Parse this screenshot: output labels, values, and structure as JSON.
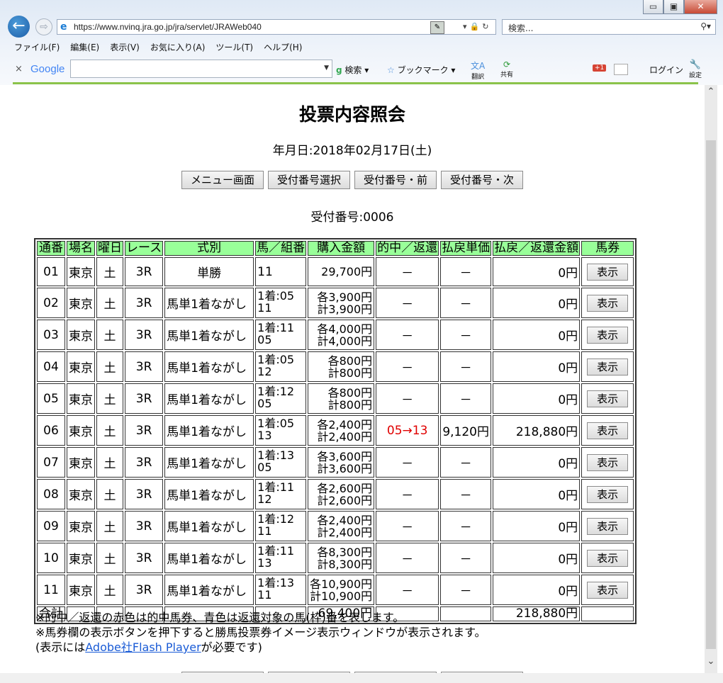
{
  "browser": {
    "url": "https://www.nvinq.jra.go.jp/jra/servlet/JRAWeb040",
    "search_placeholder": "検索...",
    "window_controls": {
      "minimize": "▭",
      "restore": "▣",
      "close": "✕"
    },
    "menu": [
      "ファイル(F)",
      "編集(E)",
      "表示(V)",
      "お気に入り(A)",
      "ツール(T)",
      "ヘルプ(H)"
    ],
    "toolbar": {
      "google_logo": "Google",
      "search_label": "検索",
      "bookmark_label": "ブックマーク",
      "translate_label": "翻訳",
      "share_label": "共有",
      "gplus_label": "+1",
      "login_label": "ログイン",
      "settings_label": "設定"
    }
  },
  "page": {
    "title": "投票内容照会",
    "date": "年月日:2018年02月17日(土)",
    "nav_buttons": [
      "メニュー画面",
      "受付番号選択",
      "受付番号・前",
      "受付番号・次"
    ],
    "receipt": "受付番号:0006",
    "table": {
      "headers": [
        "通番",
        "場名",
        "曜日",
        "レース",
        "式別",
        "馬／組番",
        "購入金額",
        "的中／返還",
        "払戻単価",
        "払戻／返還金額",
        "馬券"
      ],
      "show_label": "表示",
      "rows": [
        {
          "no": "01",
          "place": "東京",
          "day": "土",
          "race": "3R",
          "type": "単勝",
          "horse1": "11",
          "horse2": "",
          "amt1": "29,700円",
          "amt2": "",
          "hit": "－",
          "unit": "－",
          "payout": "0円"
        },
        {
          "no": "02",
          "place": "東京",
          "day": "土",
          "race": "3R",
          "type": "馬単1着ながし",
          "horse1": "1着:05",
          "horse2": "11",
          "amt1": "各3,900円",
          "amt2": "計3,900円",
          "hit": "－",
          "unit": "－",
          "payout": "0円"
        },
        {
          "no": "03",
          "place": "東京",
          "day": "土",
          "race": "3R",
          "type": "馬単1着ながし",
          "horse1": "1着:11",
          "horse2": "05",
          "amt1": "各4,000円",
          "amt2": "計4,000円",
          "hit": "－",
          "unit": "－",
          "payout": "0円"
        },
        {
          "no": "04",
          "place": "東京",
          "day": "土",
          "race": "3R",
          "type": "馬単1着ながし",
          "horse1": "1着:05",
          "horse2": "12",
          "amt1": "各800円",
          "amt2": "計800円",
          "hit": "－",
          "unit": "－",
          "payout": "0円"
        },
        {
          "no": "05",
          "place": "東京",
          "day": "土",
          "race": "3R",
          "type": "馬単1着ながし",
          "horse1": "1着:12",
          "horse2": "05",
          "amt1": "各800円",
          "amt2": "計800円",
          "hit": "－",
          "unit": "－",
          "payout": "0円"
        },
        {
          "no": "06",
          "place": "東京",
          "day": "土",
          "race": "3R",
          "type": "馬単1着ながし",
          "horse1": "1着:05",
          "horse2": "13",
          "amt1": "各2,400円",
          "amt2": "計2,400円",
          "hit": "05→13",
          "unit": "9,120円",
          "payout": "218,880円"
        },
        {
          "no": "07",
          "place": "東京",
          "day": "土",
          "race": "3R",
          "type": "馬単1着ながし",
          "horse1": "1着:13",
          "horse2": "05",
          "amt1": "各3,600円",
          "amt2": "計3,600円",
          "hit": "－",
          "unit": "－",
          "payout": "0円"
        },
        {
          "no": "08",
          "place": "東京",
          "day": "土",
          "race": "3R",
          "type": "馬単1着ながし",
          "horse1": "1着:11",
          "horse2": "12",
          "amt1": "各2,600円",
          "amt2": "計2,600円",
          "hit": "－",
          "unit": "－",
          "payout": "0円"
        },
        {
          "no": "09",
          "place": "東京",
          "day": "土",
          "race": "3R",
          "type": "馬単1着ながし",
          "horse1": "1着:12",
          "horse2": "11",
          "amt1": "各2,400円",
          "amt2": "計2,400円",
          "hit": "－",
          "unit": "－",
          "payout": "0円"
        },
        {
          "no": "10",
          "place": "東京",
          "day": "土",
          "race": "3R",
          "type": "馬単1着ながし",
          "horse1": "1着:11",
          "horse2": "13",
          "amt1": "各8,300円",
          "amt2": "計8,300円",
          "hit": "－",
          "unit": "－",
          "payout": "0円"
        },
        {
          "no": "11",
          "place": "東京",
          "day": "土",
          "race": "3R",
          "type": "馬単1着ながし",
          "horse1": "1着:13",
          "horse2": "11",
          "amt1": "各10,900円",
          "amt2": "計10,900円",
          "hit": "－",
          "unit": "－",
          "payout": "0円"
        }
      ],
      "total": {
        "label": "合計",
        "amount": "69,400円",
        "payout": "218,880円"
      }
    },
    "notes": {
      "line1": "※的中／返還の赤色は的中馬券、青色は返還対象の馬(枠)番を表します。",
      "line2": "※馬券欄の表示ボタンを押下すると勝馬投票券イメージ表示ウィンドウが表示されます。",
      "line3_pre": "(表示には",
      "line3_link": "Adobe社Flash Player",
      "line3_post": "が必要です)"
    },
    "hit_color": "#e00000",
    "header_color": "#99ff99"
  }
}
